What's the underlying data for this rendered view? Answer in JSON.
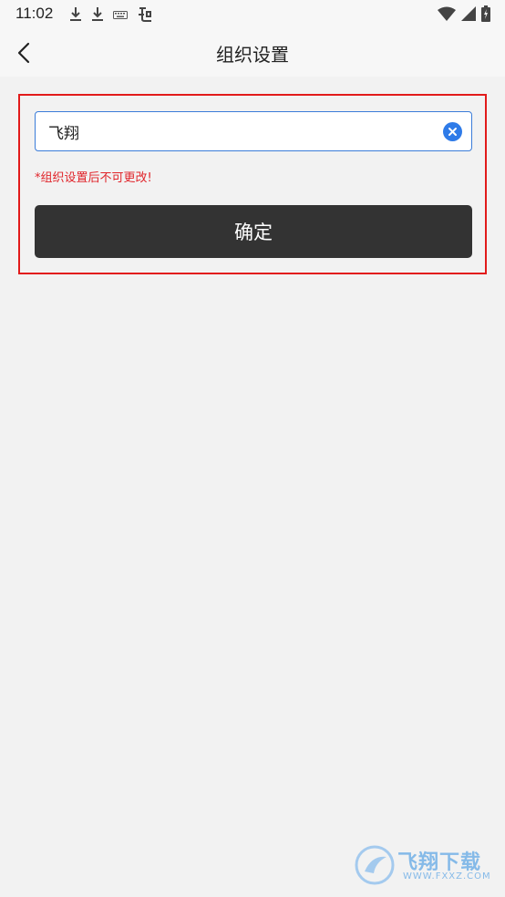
{
  "status_bar": {
    "time": "11:02",
    "icons_left": [
      "download-icon",
      "download-icon",
      "keyboard-icon",
      "app-icon"
    ],
    "icons_right": [
      "wifi-icon",
      "signal-icon",
      "battery-icon"
    ]
  },
  "header": {
    "title": "组织设置",
    "back_icon": "chevron-left-icon"
  },
  "form": {
    "name_value": "飞翔",
    "clear_icon": "clear-circle-icon",
    "warning": "*组织设置后不可更改!",
    "confirm_label": "确定",
    "colors": {
      "highlight_border": "#e21b1b",
      "input_border": "#3b7cd9",
      "clear_button": "#2f7be8",
      "warning_text": "#e0242a",
      "confirm_bg": "#333333"
    }
  },
  "watermark": {
    "brand": "飞翔下载",
    "url": "WWW.FXXZ.COM"
  }
}
